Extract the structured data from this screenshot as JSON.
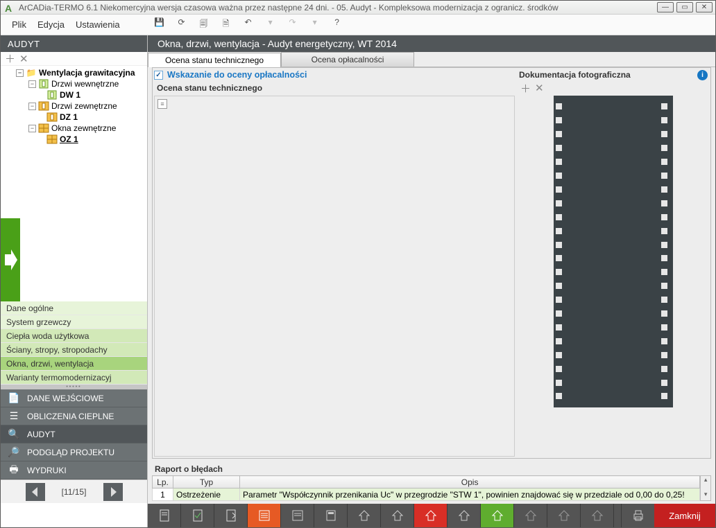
{
  "title_bar": {
    "app_icon": "A",
    "title": "ArCADia-TERMO 6.1 Niekomercyjna wersja czasowa ważna przez następne 24 dni. - 05. Audyt - Kompleksowa modernizacja z ogranicz. środków"
  },
  "menu": {
    "items": [
      "Plik",
      "Edycja",
      "Ustawienia"
    ]
  },
  "toolbar_icons": [
    "save",
    "refresh",
    "copy",
    "doc-refresh",
    "undo",
    "undo-menu",
    "redo",
    "redo-menu",
    "help"
  ],
  "sidebar": {
    "header": "AUDYT",
    "tree": {
      "root": "Wentylacja grawitacyjna",
      "groups": [
        {
          "label": "Drzwi wewnętrzne",
          "children": [
            "DW 1"
          ]
        },
        {
          "label": "Drzwi zewnętrzne",
          "children": [
            "DZ 1"
          ]
        },
        {
          "label": "Okna zewnętrzne",
          "children": [
            "OZ 1"
          ],
          "selected_child": "OZ 1"
        }
      ]
    },
    "sub_items": [
      {
        "label": "Dane ogólne",
        "style": "light"
      },
      {
        "label": "System grzewczy",
        "style": "light"
      },
      {
        "label": "Ciepła woda użytkowa",
        "style": "mid"
      },
      {
        "label": "Ściany, stropy, stropodachy",
        "style": "mid"
      },
      {
        "label": "Okna, drzwi, wentylacja",
        "style": "sel"
      },
      {
        "label": "Warianty termomodernizacyj",
        "style": "mid"
      }
    ],
    "big_nav": [
      {
        "icon": "📄",
        "label": "DANE WEJŚCIOWE"
      },
      {
        "icon": "☰",
        "label": "OBLICZENIA CIEPLNE"
      },
      {
        "icon": "🔍",
        "label": "AUDYT",
        "active": true
      },
      {
        "icon": "🔎",
        "label": "PODGLĄD PROJEKTU"
      },
      {
        "icon": "🖶",
        "label": "WYDRUKI"
      }
    ],
    "page_indicator": "[11/15]"
  },
  "content": {
    "header": "Okna, drzwi, wentylacja - Audyt energetyczny, WT 2014",
    "tabs": {
      "active": "Ocena stanu technicznego",
      "other": "Ocena opłacalności"
    },
    "checkbox_label": "Wskazanie do oceny opłacalności",
    "section_title": "Ocena stanu technicznego",
    "doc_section": "Dokumentacja fotograficzna"
  },
  "error_report": {
    "title": "Raport o błędach",
    "headers": {
      "lp": "Lp.",
      "type": "Typ",
      "desc": "Opis"
    },
    "rows": [
      {
        "lp": "1",
        "type": "Ostrzeżenie",
        "desc": "Parametr \"Współczynnik przenikania Uc\" w przegrodzie \"STW 1\", powinien znajdować się w przedziale od 0,00 do 0,25!"
      }
    ]
  },
  "bottom": {
    "close": "Zamknij"
  }
}
